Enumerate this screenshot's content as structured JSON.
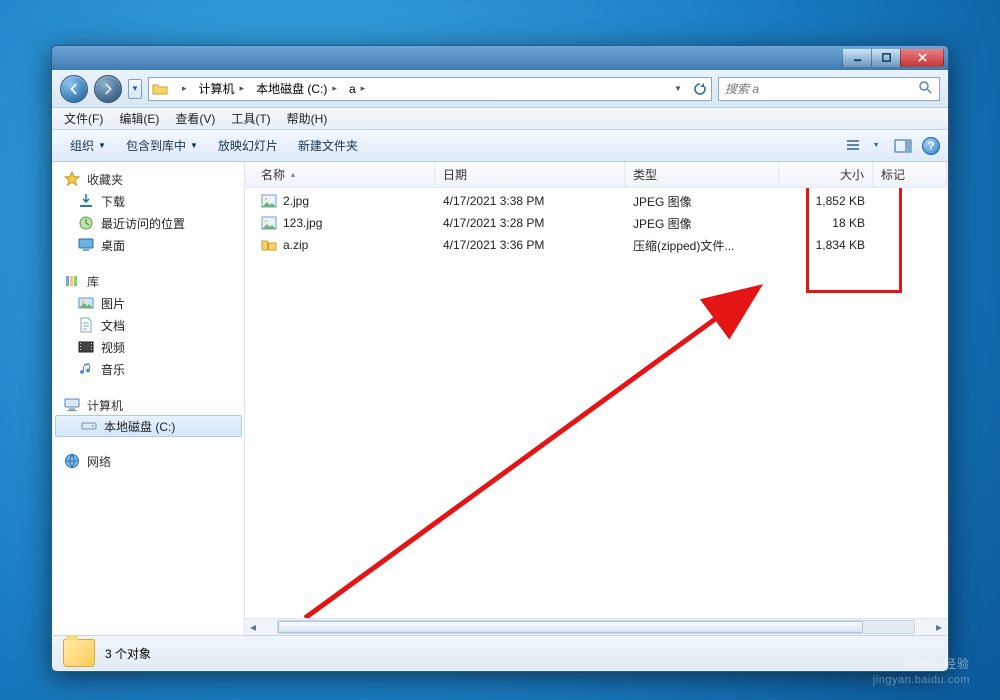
{
  "menus": {
    "file": "文件(F)",
    "edit": "编辑(E)",
    "view": "查看(V)",
    "tools": "工具(T)",
    "help": "帮助(H)"
  },
  "toolbar": {
    "organize": "组织",
    "include": "包含到库中",
    "slideshow": "放映幻灯片",
    "newfolder": "新建文件夹"
  },
  "breadcrumb": {
    "computer": "计算机",
    "drive": "本地磁盘 (C:)",
    "folder": "a"
  },
  "search": {
    "placeholder": "搜索 a"
  },
  "columns": {
    "name": "名称",
    "date": "日期",
    "type": "类型",
    "size": "大小",
    "mark": "标记"
  },
  "sidebar": {
    "favorites": "收藏夹",
    "fav_items": {
      "downloads": "下载",
      "recent": "最近访问的位置",
      "desktop": "桌面"
    },
    "library": "库",
    "lib_items": {
      "pictures": "图片",
      "documents": "文档",
      "videos": "视频",
      "music": "音乐"
    },
    "computer": "计算机",
    "comp_items": {
      "cdrive": "本地磁盘 (C:)"
    },
    "network": "网络"
  },
  "files": [
    {
      "name": "2.jpg",
      "date": "4/17/2021 3:38 PM",
      "type": "JPEG 图像",
      "size": "1,852 KB",
      "icon": "image"
    },
    {
      "name": "123.jpg",
      "date": "4/17/2021 3:28 PM",
      "type": "JPEG 图像",
      "size": "18 KB",
      "icon": "image"
    },
    {
      "name": "a.zip",
      "date": "4/17/2021 3:36 PM",
      "type": "压缩(zipped)文件...",
      "size": "1,834 KB",
      "icon": "zip"
    }
  ],
  "status": {
    "count": "3 个对象"
  },
  "watermark": {
    "brand": "Baidu 经验",
    "sub": "jingyan.baidu.com"
  }
}
